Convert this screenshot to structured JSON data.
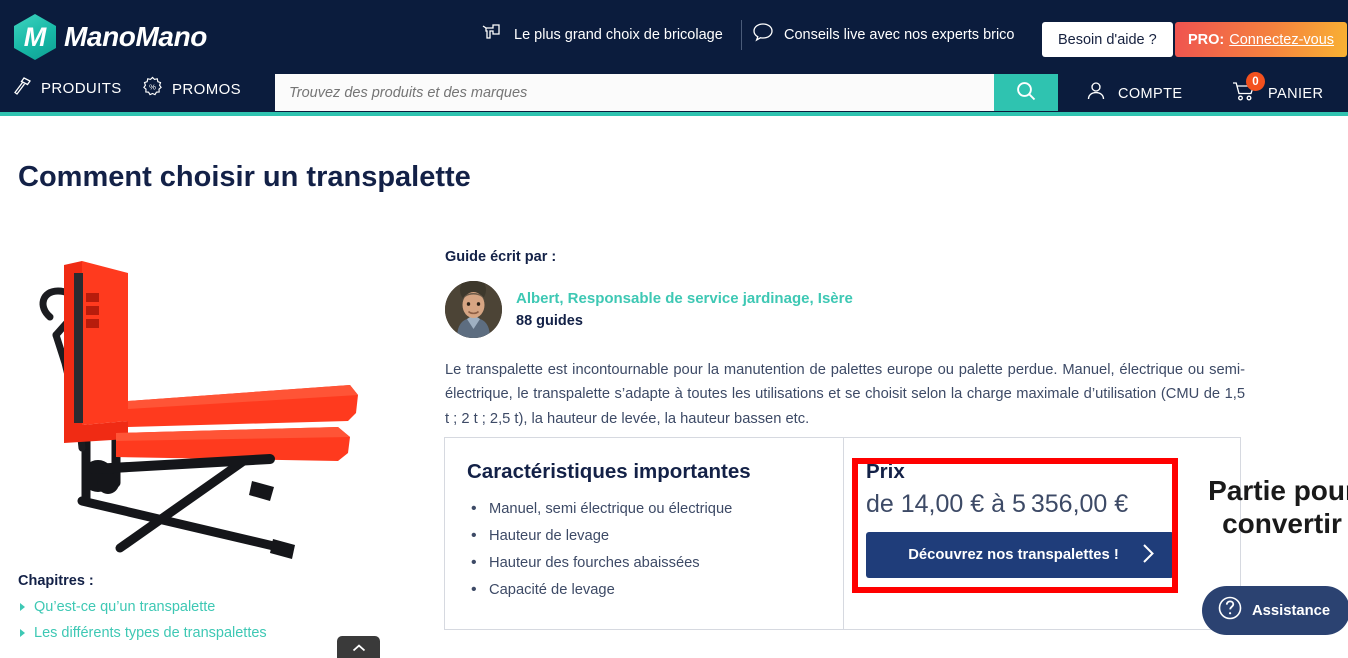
{
  "header": {
    "brand": {
      "mark": "M",
      "name": "ManoMano"
    },
    "promise": {
      "icon": "drill-icon",
      "text": "Le plus grand choix de bricolage"
    },
    "chat": {
      "icon": "speech-bubble-icon",
      "text": "Conseils live avec nos experts brico"
    },
    "help_button": "Besoin d'aide ?",
    "pro": {
      "label": "PRO:",
      "link": "Connectez-vous"
    },
    "nav": [
      {
        "id": "produits",
        "icon": "hammer-icon",
        "label": "PRODUITS"
      },
      {
        "id": "promos",
        "icon": "discount-burst-icon",
        "label": "PROMOS"
      }
    ],
    "search": {
      "placeholder": "Trouvez des produits et des marques",
      "value": "",
      "icon": "search-icon"
    },
    "account": {
      "icon": "user-icon",
      "label": "COMPTE"
    },
    "cart": {
      "icon": "cart-icon",
      "label": "PANIER",
      "count": "0"
    },
    "colors": {
      "navy": "#0b1c3d",
      "teal": "#2fc3b0",
      "cart_badge": "#f4511e"
    }
  },
  "page": {
    "title": "Comment choisir un transpalette",
    "product_image_alt": "transpalette-haute-levee-rouge"
  },
  "chapters": {
    "heading": "Chapitres :",
    "items": [
      {
        "label": "Qu’est-ce qu’un transpalette"
      },
      {
        "label": "Les différents types de transpalettes"
      }
    ]
  },
  "scroll_top": {
    "icon": "chevron-up-icon"
  },
  "author": {
    "heading": "Guide écrit par :",
    "avatar": "author-photo",
    "name": "Albert, Responsable de service jardinage, Isère",
    "guides": "88 guides"
  },
  "intro": "Le transpalette est incontournable pour la manutention de palettes europe ou palette perdue. Manuel, électrique ou semi-électrique, le transpalette s’adapte à toutes les utilisations et se choisit selon la charge maximale d’utilisation (CMU de 1,5 t ; 2 t ; 2,5 t), la hauteur de levée, la hauteur bassen etc.",
  "card": {
    "features_title": "Caractéristiques importantes",
    "features": [
      "Manuel, semi électrique ou électrique",
      "Hauteur de levage",
      "Hauteur des fourches abaissées",
      "Capacité de levage"
    ],
    "price_title": "Prix",
    "price_value": "de 14,00 € à 5 356,00 €",
    "cta_label": "Découvrez nos transpalettes !",
    "cta_icon": "chevron-right-icon"
  },
  "annotation": {
    "text": "Partie pour convertir",
    "box_color": "#ff0000"
  },
  "assistance": {
    "icon": "question-circle-icon",
    "label": "Assistance"
  }
}
